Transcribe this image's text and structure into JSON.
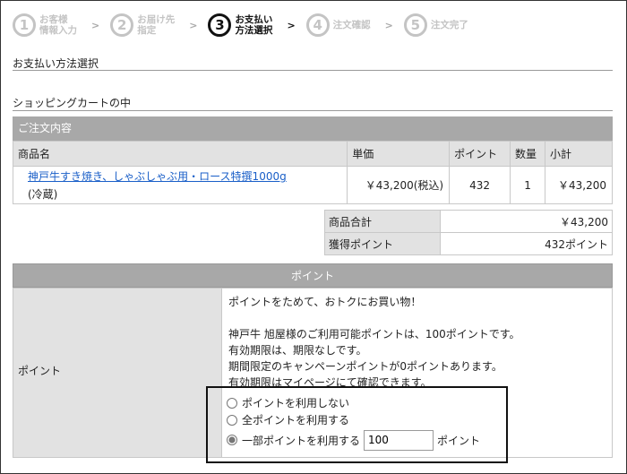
{
  "steps": [
    {
      "num": "1",
      "line1": "お客様",
      "line2": "情報入力"
    },
    {
      "num": "2",
      "line1": "お届け先",
      "line2": "指定"
    },
    {
      "num": "3",
      "line1": "お支払い",
      "line2": "方法選択"
    },
    {
      "num": "4",
      "line1": "注文確認",
      "line2": ""
    },
    {
      "num": "5",
      "line1": "注文完了",
      "line2": ""
    }
  ],
  "sections": {
    "payment_method": "お支払い方法選択",
    "cart": "ショッピングカートの中"
  },
  "order": {
    "header": "ご注文内容",
    "columns": [
      "商品名",
      "単価",
      "ポイント",
      "数量",
      "小計"
    ],
    "rows": [
      {
        "name": "神戸牛すき焼き、しゃぶしゃぶ用・ロース特撰1000g",
        "note": "(冷蔵)",
        "price": "￥43,200(税込)",
        "points": "432",
        "qty": "1",
        "subtotal": "￥43,200"
      }
    ]
  },
  "summary": {
    "total_label": "商品合計",
    "total_value": "￥43,200",
    "points_label": "獲得ポイント",
    "points_value": "432ポイント"
  },
  "points": {
    "header": "ポイント",
    "label": "ポイント",
    "lines": [
      "ポイントをためて、おトクにお買い物！",
      "神戸牛 旭屋様のご利用可能ポイントは、100ポイントです。",
      "有効期限は、期限なしです。",
      "期間限定のキャンペーンポイントが0ポイントあります。",
      "有効期限はマイページにて確認できます。"
    ],
    "options": {
      "none": "ポイントを利用しない",
      "all": "全ポイントを利用する",
      "partial": "一部ポイントを利用する",
      "partial_value": "100",
      "partial_unit": "ポイント"
    }
  }
}
